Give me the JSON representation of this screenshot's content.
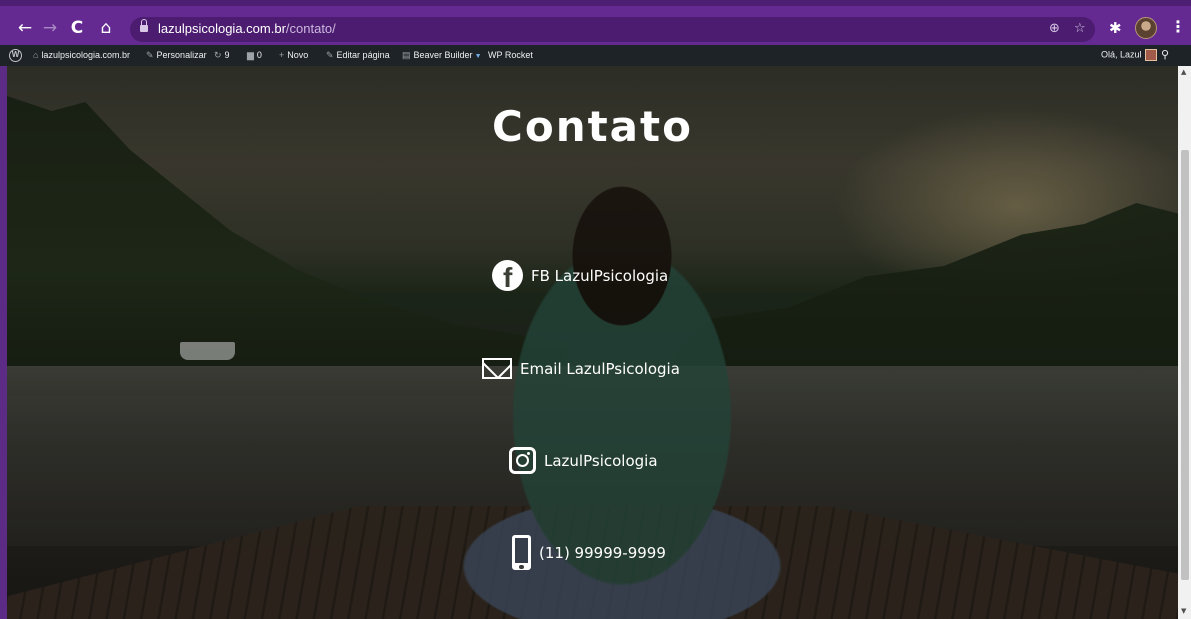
{
  "browser": {
    "url_domain": "lazulpsicologia.com.br",
    "url_path": "/contato/",
    "nav": {
      "back": "←",
      "forward": "→",
      "reload": "C",
      "home": "⌂"
    },
    "omnibox_icons": {
      "zoom": "⊕",
      "bookmark": "☆"
    },
    "extensions_icon": "✱",
    "menu": "⋮"
  },
  "wp_admin_bar": {
    "site": "lazulpsicologia.com.br",
    "customize": "Personalizar",
    "updates": "9",
    "comments": "0",
    "new": "Novo",
    "edit": "Editar página",
    "beaver": "Beaver Builder",
    "rocket": "WP Rocket",
    "greeting": "Olá, Lazul"
  },
  "page": {
    "title": "Contato",
    "contacts": [
      {
        "icon": "facebook-icon",
        "label": "FB LazulPsicologia"
      },
      {
        "icon": "mail-icon",
        "label": "Email LazulPsicologia"
      },
      {
        "icon": "instagram-icon",
        "label": "LazulPsicologia"
      },
      {
        "icon": "phone-icon",
        "label": "(11) 99999-9999"
      }
    ]
  }
}
